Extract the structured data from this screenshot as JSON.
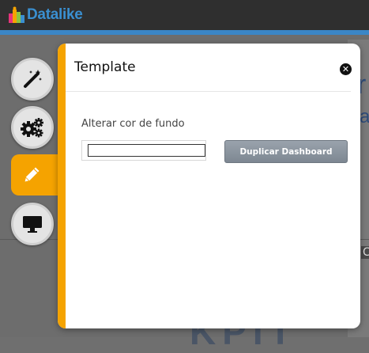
{
  "app": {
    "brand": "Datalike",
    "brand_color": "#3a8fd0"
  },
  "modal": {
    "title": "Template",
    "close_icon": "close-circle-icon",
    "accent_color": "#f5a300",
    "field_label": "Alterar cor de fundo",
    "color_value": "",
    "duplicate_button": "Duplicar Dashboard"
  },
  "side_tabs": [
    {
      "name": "wizard",
      "icon": "magic-wand-icon",
      "active": false
    },
    {
      "name": "settings",
      "icon": "gears-icon",
      "active": false
    },
    {
      "name": "edit",
      "icon": "pencil-icon",
      "active": true
    },
    {
      "name": "display",
      "icon": "monitor-icon",
      "active": false
    }
  ],
  "background": {
    "letter_1": "r",
    "letter_2": "a",
    "letter_3": "C",
    "big_text": "KPIT"
  }
}
